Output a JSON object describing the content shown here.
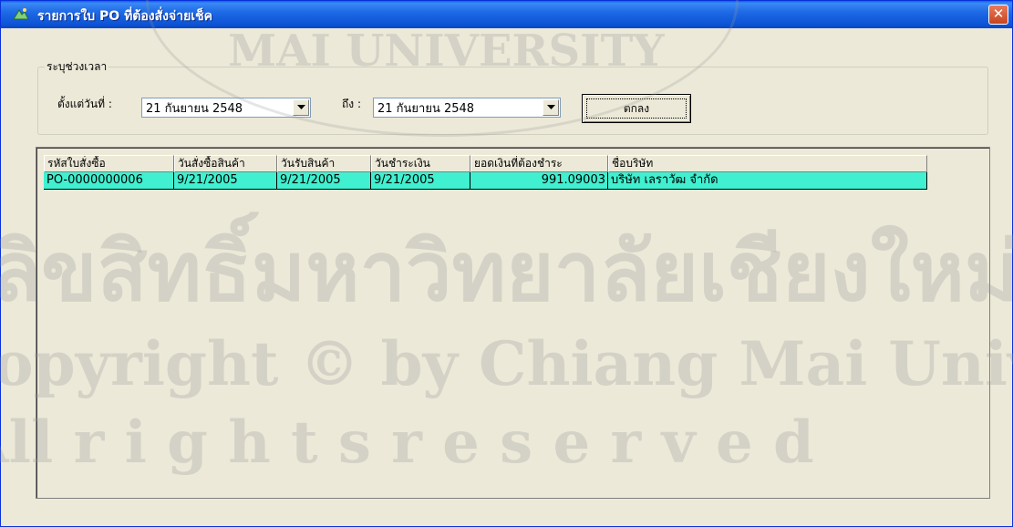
{
  "window": {
    "title": "รายการใบ PO ที่ต้องสั่งจ่ายเช็ค",
    "close_glyph": "✕"
  },
  "filter": {
    "group_label": "ระบุช่วงเวลา",
    "from_label": "ตั้งแต่วันที่ :",
    "from_value": "21  กันยายน   2548",
    "to_label": "ถึง :",
    "to_value": "21  กันยายน   2548",
    "ok_label": "ตกลง"
  },
  "grid": {
    "columns": [
      "รหัสใบสั่งซื้อ",
      "วันสั่งซื้อสินค้า",
      "วันรับสินค้า",
      "วันชำระเงิน",
      "ยอดเงินที่ต้องชำระ",
      "ชื่อบริษัท"
    ],
    "rows": [
      {
        "po_code": "PO-0000000006",
        "order_date": "9/21/2005",
        "receive_date": "9/21/2005",
        "pay_date": "9/21/2005",
        "amount": "991.09003",
        "company": "บริษัท เลราวัฒ จำกัด"
      }
    ],
    "selected_row_color": "#40f0d0"
  },
  "watermark": {
    "line1": "ลิขสิทธิ์มหาวิทยาลัยเชียงใหม่",
    "line2": "Copyright © by Chiang Mai University",
    "line3": "All  r i g h t s   r e s e r v e d",
    "seal_text": "MAI UNIVERSITY"
  },
  "colors": {
    "titlebar": "#0c54d6",
    "dialog_bg": "#ece9d8",
    "selection": "#40f0d0"
  },
  "icons": {
    "app": "app-icon",
    "close": "close-icon",
    "dropdown": "chevron-down-icon"
  }
}
